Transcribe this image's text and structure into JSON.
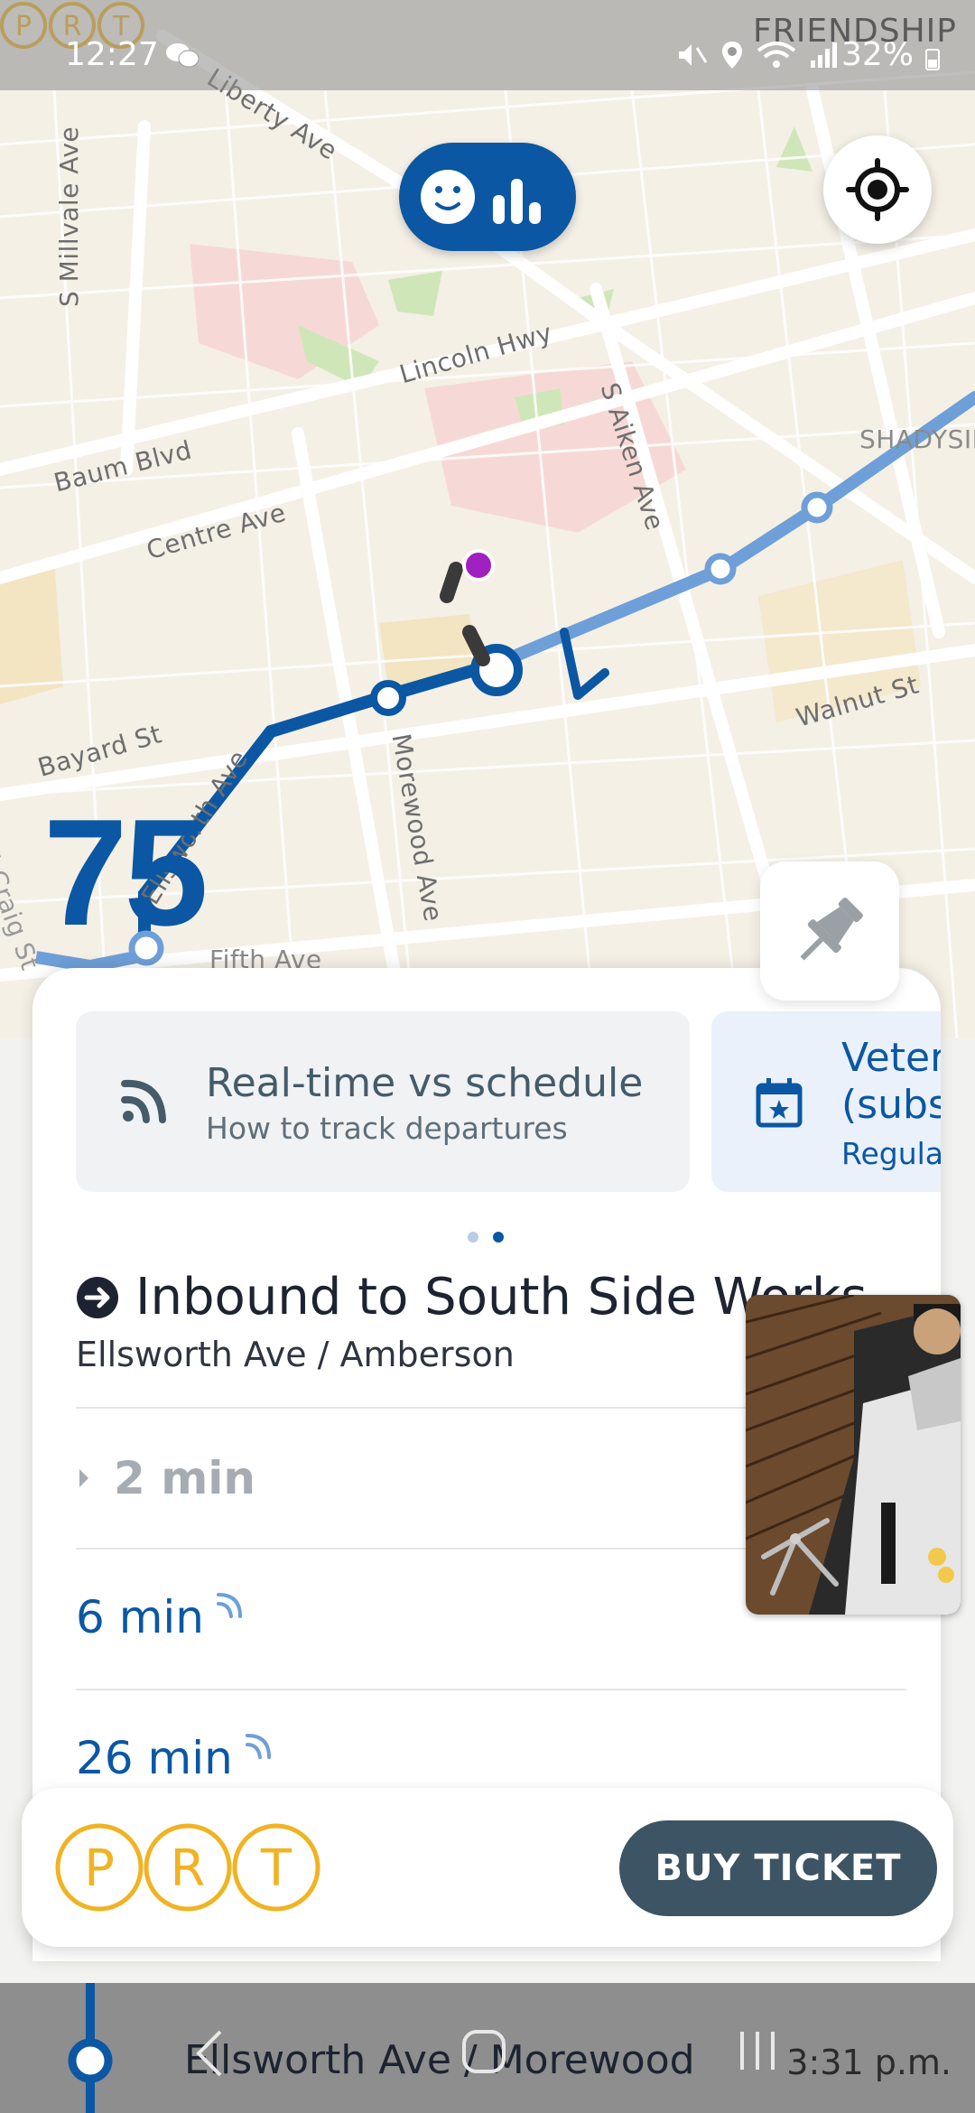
{
  "status_bar": {
    "time": "12:27",
    "battery": "32%",
    "icons": [
      "wechat-icon",
      "mute-icon",
      "location-icon",
      "wifi-icon",
      "signal-icon",
      "battery-icon"
    ]
  },
  "map": {
    "corner_label": "FRIENDSHIP",
    "streets": [
      "Liberty Ave",
      "S Millvale Ave",
      "Lincoln Hwy",
      "Baum Blvd",
      "Centre Ave",
      "S Aiken Ave",
      "SHADYSIDE",
      "Walnut St",
      "Bayard St",
      "Morewood Ave",
      "N Craig St",
      "Ellsworth Ave",
      "Fifth Ave"
    ],
    "route_color": "#0b57a4",
    "route_color_light": "#6e9fd8"
  },
  "route": {
    "number": "75",
    "agency_logo": "PRT"
  },
  "cards": [
    {
      "title": "Real-time vs schedule",
      "subtitle": "How to track departures",
      "icon": "realtime-icon"
    },
    {
      "title_line1": "Veter",
      "title_line2": "(subs",
      "subtitle": "Regular",
      "icon": "calendar-star-icon"
    }
  ],
  "direction": {
    "title": "Inbound to South Side Works",
    "stop": "Ellsworth Ave / Amberson"
  },
  "departures": [
    {
      "label": "2 min",
      "realtime": false
    },
    {
      "label": "6 min",
      "realtime": true
    },
    {
      "label": "26 min",
      "realtime": true
    }
  ],
  "footer": {
    "logo": "PRT",
    "buy_label": "BUY TICKET"
  },
  "next_stop": {
    "name": "Ellsworth Ave / Morewood",
    "time": "3:31 p.m."
  },
  "colors": {
    "brand_blue": "#0b57a4",
    "prt_yellow": "#f0b323",
    "button_dark": "#3c5463"
  }
}
